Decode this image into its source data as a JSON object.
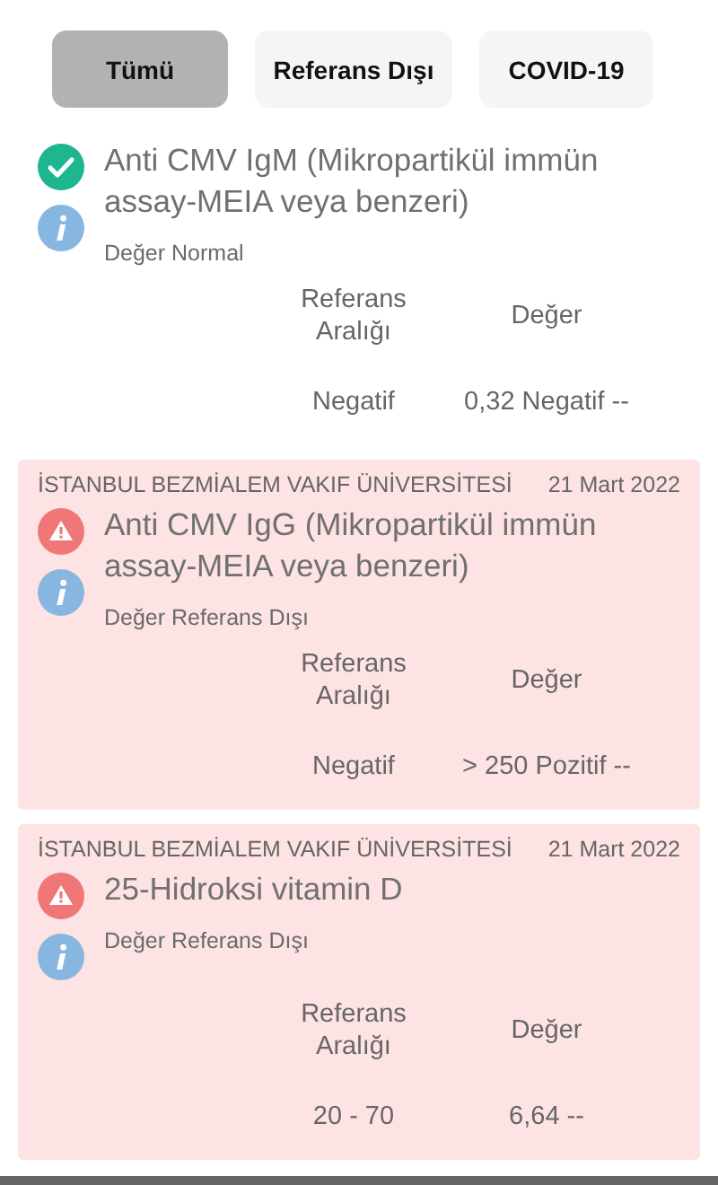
{
  "filters": [
    {
      "label": "Tümü",
      "selected": true
    },
    {
      "label": "Referans Dışı",
      "selected": false
    },
    {
      "label": "COVID-19",
      "selected": false
    }
  ],
  "results": [
    {
      "out_of_range": false,
      "title": "Anti CMV IgM (Mikropartikül immün assay-MEIA veya benzeri)",
      "note": "Değer Normal",
      "ref_header": "Referans Aralığı",
      "value_header": "Değer",
      "ref": "Negatif",
      "value": "0,32 Negatif --"
    },
    {
      "institution": "İSTANBUL BEZMİALEM VAKIF ÜNİVERSİTESİ",
      "date": "21 Mart 2022",
      "out_of_range": true,
      "title": "Anti CMV IgG (Mikropartikül immün assay-MEIA veya benzeri)",
      "note": "Değer Referans Dışı",
      "ref_header": "Referans Aralığı",
      "value_header": "Değer",
      "ref": "Negatif",
      "value": "> 250 Pozitif --"
    },
    {
      "institution": "İSTANBUL BEZMİALEM VAKIF ÜNİVERSİTESİ",
      "date": "21 Mart 2022",
      "out_of_range": true,
      "title": "25-Hidroksi vitamin D",
      "note": "Değer Referans Dışı",
      "ref_header": "Referans Aralığı",
      "value_header": "Değer",
      "ref": "20 - 70",
      "value": "6,64 --"
    }
  ]
}
